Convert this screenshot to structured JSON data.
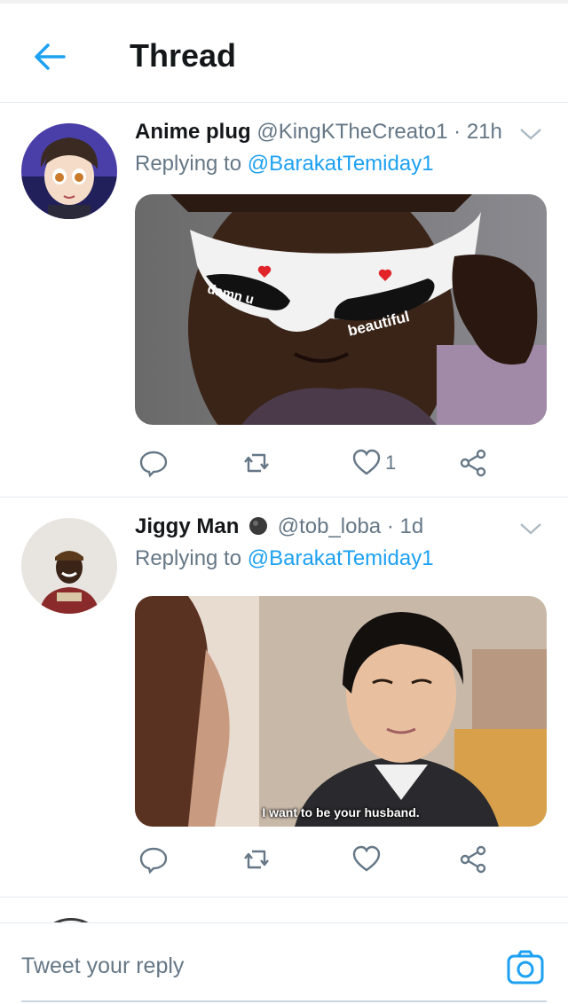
{
  "header": {
    "title": "Thread"
  },
  "tweets": [
    {
      "name": "Anime plug",
      "handle": "@KingKTheCreato1",
      "time": "· 21h",
      "reply_prefix": "Replying to ",
      "reply_to": "@BarakatTemiday1",
      "media_text_left": "damn u",
      "media_text_right": "beautiful",
      "likes": "1"
    },
    {
      "name": "Jiggy Man",
      "handle": "@tob_loba",
      "time": "· 1d",
      "reply_prefix": "Replying to ",
      "reply_to": "@BarakatTemiday1",
      "media_caption": "I want to be your husband."
    }
  ],
  "composer": {
    "placeholder": "Tweet your reply"
  },
  "colors": {
    "accent": "#1da1f2",
    "muted": "#657786",
    "text": "#14171a",
    "border": "#e6ecf0"
  },
  "icons": [
    "back-arrow-icon",
    "chevron-down-icon",
    "reply-icon",
    "retweet-icon",
    "like-icon",
    "share-icon",
    "camera-icon"
  ]
}
